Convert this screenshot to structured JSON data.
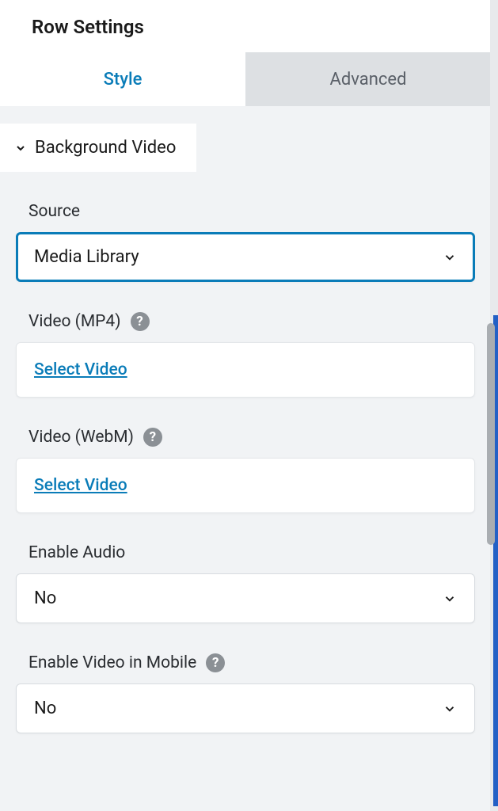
{
  "header": {
    "title": "Row Settings"
  },
  "tabs": {
    "active": "Style",
    "inactive": "Advanced"
  },
  "section": {
    "title": "Background Video"
  },
  "fields": {
    "source": {
      "label": "Source",
      "value": "Media Library"
    },
    "video_mp4": {
      "label": "Video (MP4)",
      "link": "Select Video"
    },
    "video_webm": {
      "label": "Video (WebM)",
      "link": "Select Video"
    },
    "enable_audio": {
      "label": "Enable Audio",
      "value": "No"
    },
    "enable_video_mobile": {
      "label": "Enable Video in Mobile",
      "value": "No"
    }
  }
}
